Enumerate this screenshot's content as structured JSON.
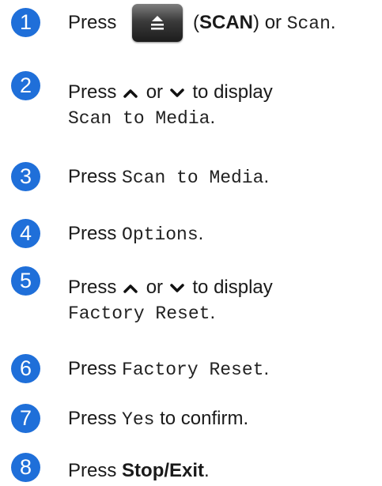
{
  "accent_color": "#1f6fd9",
  "steps": [
    {
      "num": "1",
      "press": "Press",
      "paren_open": "(",
      "scan_label": "SCAN",
      "paren_close": ")",
      "or": "or",
      "scan_mono": "Scan",
      "end": "."
    },
    {
      "num": "2",
      "press": "Press",
      "or": "or",
      "to_display": "to display",
      "target": "Scan to Media",
      "end": "."
    },
    {
      "num": "3",
      "press": "Press",
      "target": "Scan to Media",
      "end": "."
    },
    {
      "num": "4",
      "press": "Press",
      "target": "Options",
      "end": "."
    },
    {
      "num": "5",
      "press": "Press",
      "or": "or",
      "to_display": "to display",
      "target": "Factory Reset",
      "end": "."
    },
    {
      "num": "6",
      "press": "Press",
      "target": "Factory Reset",
      "end": "."
    },
    {
      "num": "7",
      "press": "Press",
      "target": "Yes",
      "rest": "to confirm."
    },
    {
      "num": "8",
      "press": "Press",
      "target": "Stop/Exit",
      "end": "."
    }
  ],
  "icons": {
    "scan_button": "scan-key-icon",
    "up": "chevron-up-icon",
    "down": "chevron-down-icon"
  }
}
